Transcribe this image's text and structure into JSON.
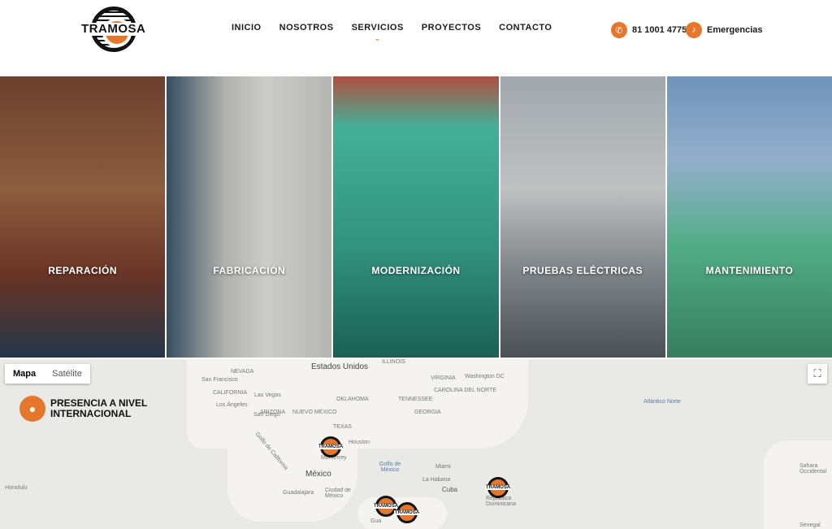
{
  "brand": {
    "name": "TRAMOSA",
    "accent": "#e4772b"
  },
  "nav": [
    {
      "label": "INICIO"
    },
    {
      "label": "NOSOTROS"
    },
    {
      "label": "SERVICIOS"
    },
    {
      "label": "PROYECTOS"
    },
    {
      "label": "CONTACTO"
    }
  ],
  "contact": {
    "phone": "81 1001 4775",
    "emergency": "Emergencias",
    "phone_icon": "phone-icon",
    "emergency_icon": "bell-icon"
  },
  "services": [
    {
      "label": "REPARACIÓN"
    },
    {
      "label": "FABRICACIÓN"
    },
    {
      "label": "MODERNIZACIÓN"
    },
    {
      "label": "PRUEBAS ELÉCTRICAS"
    },
    {
      "label": "MANTENIMIENTO"
    }
  ],
  "map": {
    "map_type_map": "Mapa",
    "map_type_satellite": "Satélite",
    "presence_title": "PRESENCIA A NIVEL INTERNACIONAL",
    "labels": {
      "usa": "Estados Unidos",
      "mexico": "México",
      "gulf": "Golfo de México",
      "atlantic": "Atlántico Norte",
      "cuba": "Cuba",
      "sahara": "Sahara Occidental",
      "senegal": "Senegal",
      "rep_dominicana": "República Dominicana",
      "san_francisco": "San Francisco",
      "los_angeles": "Los Ángeles",
      "las_vegas": "Las Vegas",
      "san_diego": "San Diego",
      "houston": "Houston",
      "monterrey": "Monterrey",
      "guadalajara": "Guadalajara",
      "ciudad_mexico": "Ciudad de México",
      "washington": "Washington DC",
      "miami": "Miami",
      "la_habana": "La Habana",
      "honolulu": "Honolulu",
      "nevada": "NEVADA",
      "california": "CALIFORNIA",
      "texas": "TEXAS",
      "oklahoma": "OKLAHOMA",
      "illinois": "ILLINOIS",
      "virginia": "VIRGINIA",
      "tennessee": "TENNESSEE",
      "georgia": "GEORGIA",
      "arizona": "ARIZONA",
      "nuevo_mexico": "NUEVO MÉXICO",
      "golfo_california": "Golfo de California",
      "north_carolina": "CAROLINA DEL NORTE",
      "guatemala": "Gua"
    },
    "marker_label": "TRAMOSA"
  }
}
